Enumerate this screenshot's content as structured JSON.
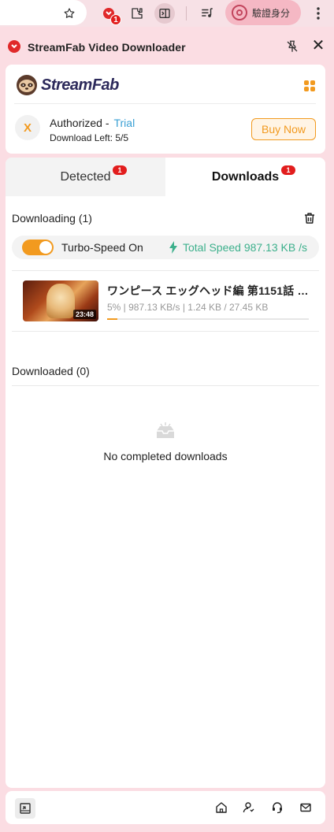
{
  "browser": {
    "verify_label": "驗證身分",
    "extension_badge": "1"
  },
  "panel": {
    "title": "StreamFab Video Downloader"
  },
  "brand": {
    "name": "StreamFab"
  },
  "account": {
    "avatar_letter": "X",
    "authorized_label": "Authorized -",
    "plan": "Trial",
    "download_left": "Download Left: 5/5",
    "buy_button": "Buy Now"
  },
  "tabs": [
    {
      "label": "Detected",
      "badge": "1"
    },
    {
      "label": "Downloads",
      "badge": "1"
    }
  ],
  "downloading": {
    "title": "Downloading (1)",
    "turbo_label": "Turbo-Speed On",
    "turbo_on": true,
    "total_speed": "Total Speed 987.13 KB /s",
    "items": [
      {
        "title": "ワンピース エッグヘッド編 第1151話 …",
        "duration": "23:48",
        "stats": "5% | 987.13 KB/s | 1.24 KB / 27.45 KB",
        "progress": 0.05
      }
    ]
  },
  "downloaded": {
    "title": "Downloaded (0)",
    "empty_text": "No completed downloads"
  },
  "colors": {
    "accent": "#f29a1f",
    "speed": "#3db08c",
    "trial": "#3aa0d4",
    "badge": "#e21d1d"
  },
  "icons": {
    "browser": [
      "star-icon",
      "extension-icon",
      "puzzle-icon",
      "side-panel-icon",
      "media-control-icon",
      "verify-icon",
      "kebab-menu-icon"
    ],
    "bottom_bar": [
      "collapse-icon",
      "home-icon",
      "account-icon",
      "support-icon",
      "mail-icon"
    ]
  }
}
